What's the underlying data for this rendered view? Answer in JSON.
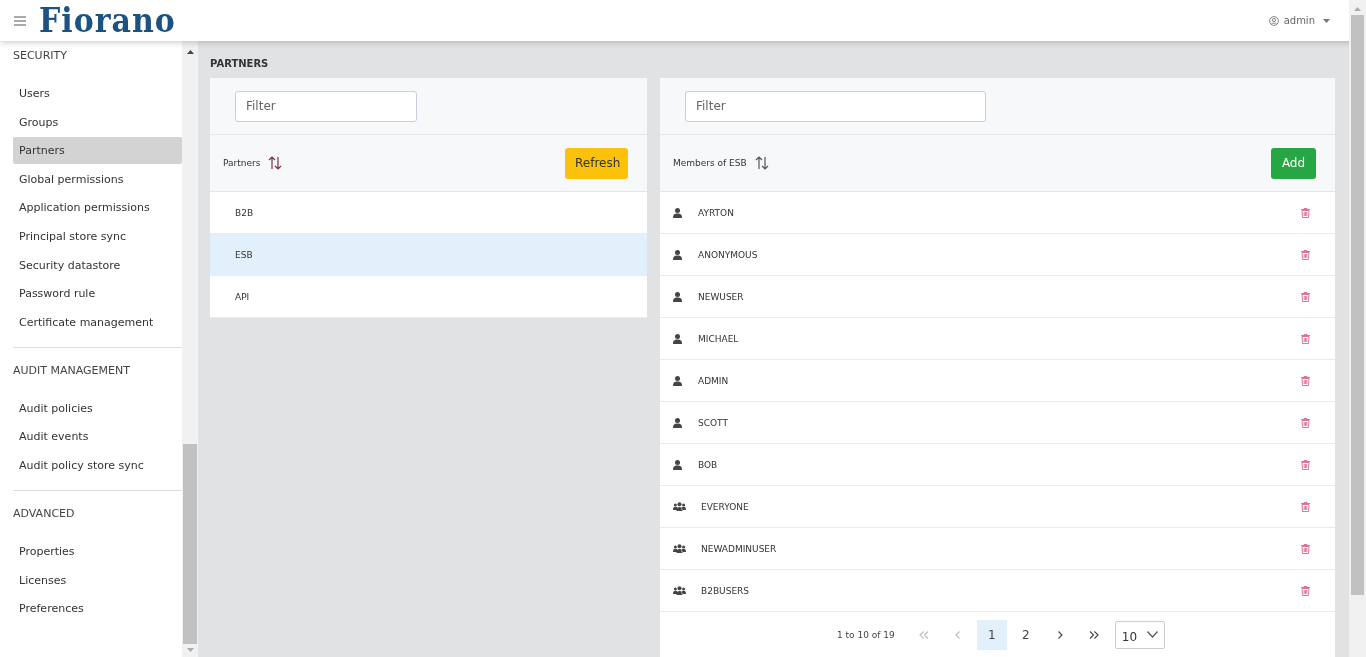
{
  "header": {
    "logo": "Fiorano",
    "user": "admin"
  },
  "sidebar": {
    "sections": [
      {
        "title": "SECURITY",
        "items": [
          {
            "label": "Users",
            "selected": false
          },
          {
            "label": "Groups",
            "selected": false
          },
          {
            "label": "Partners",
            "selected": true
          },
          {
            "label": "Global permissions",
            "selected": false
          },
          {
            "label": "Application permissions",
            "selected": false
          },
          {
            "label": "Principal store sync",
            "selected": false
          },
          {
            "label": "Security datastore",
            "selected": false
          },
          {
            "label": "Password rule",
            "selected": false
          },
          {
            "label": "Certificate management",
            "selected": false
          }
        ]
      },
      {
        "title": "AUDIT MANAGEMENT",
        "items": [
          {
            "label": "Audit policies",
            "selected": false
          },
          {
            "label": "Audit events",
            "selected": false
          },
          {
            "label": "Audit policy store sync",
            "selected": false
          }
        ]
      },
      {
        "title": "ADVANCED",
        "items": [
          {
            "label": "Properties",
            "selected": false
          },
          {
            "label": "Licenses",
            "selected": false
          },
          {
            "label": "Preferences",
            "selected": false
          }
        ]
      }
    ]
  },
  "page_title": "PARTNERS",
  "partners_panel": {
    "filter": {
      "placeholder": "Filter"
    },
    "heading": "Partners",
    "button": "Refresh",
    "rows": [
      {
        "name": "B2B",
        "selected": false
      },
      {
        "name": "ESB",
        "selected": true
      },
      {
        "name": "API",
        "selected": false
      }
    ]
  },
  "members_panel": {
    "filter": {
      "placeholder": "Filter"
    },
    "heading": "Members of ESB",
    "button": "Add",
    "rows": [
      {
        "kind": "user",
        "name": "AYRTON"
      },
      {
        "kind": "user",
        "name": "ANONYMOUS"
      },
      {
        "kind": "user",
        "name": "NEWUSER"
      },
      {
        "kind": "user",
        "name": "MICHAEL"
      },
      {
        "kind": "user",
        "name": "ADMIN"
      },
      {
        "kind": "user",
        "name": "SCOTT"
      },
      {
        "kind": "user",
        "name": "BOB"
      },
      {
        "kind": "group",
        "name": "EVERYONE"
      },
      {
        "kind": "group",
        "name": "NEWADMINUSER"
      },
      {
        "kind": "group",
        "name": "B2BUSERS"
      }
    ],
    "pagination": {
      "summary": "1 to 10 of 19",
      "first_disabled": true,
      "prev_disabled": true,
      "next_disabled": false,
      "last_disabled": false,
      "pages": [
        {
          "label": "1",
          "selected": true
        },
        {
          "label": "2",
          "selected": false
        }
      ],
      "page_size": "10"
    }
  }
}
